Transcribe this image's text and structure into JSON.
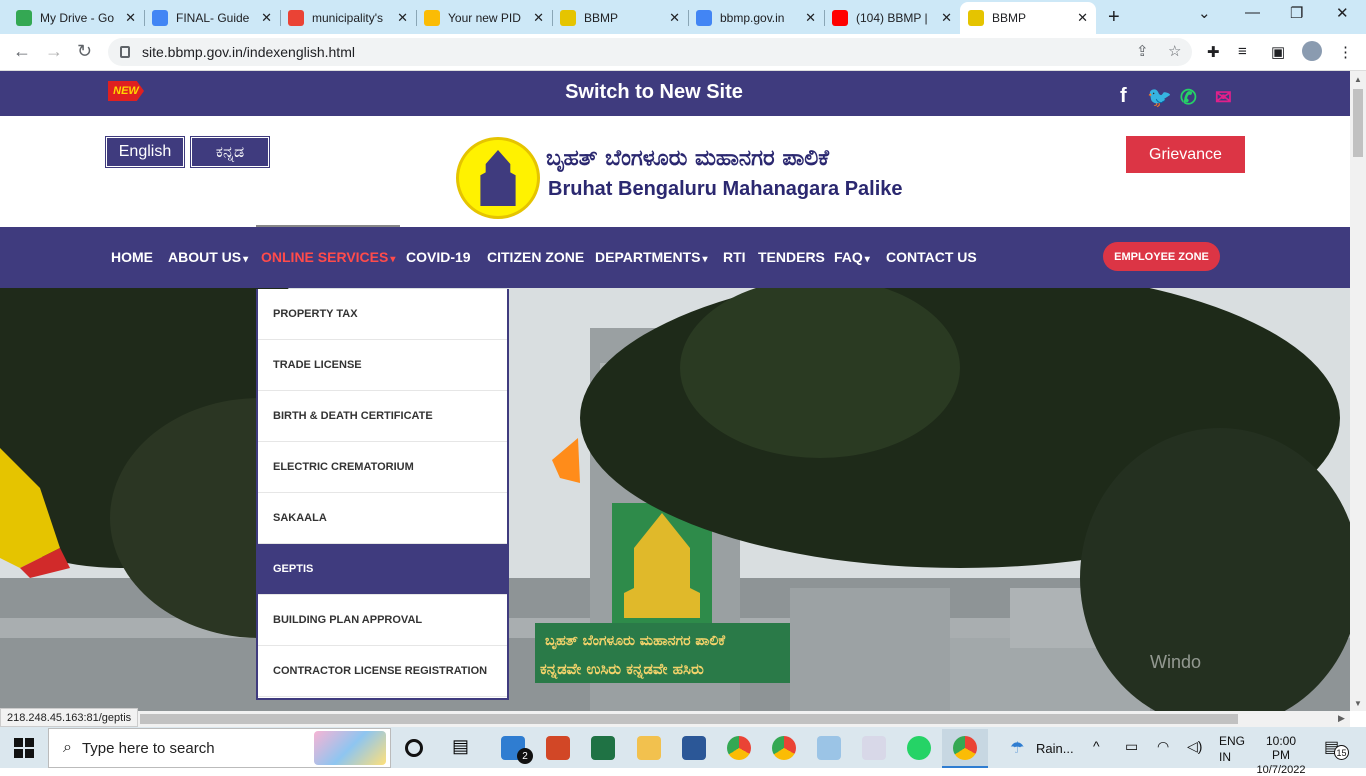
{
  "browser": {
    "tabs": [
      {
        "title": "My Drive - Go",
        "color": "#34a853"
      },
      {
        "title": "FINAL- Guide",
        "color": "#4285f4"
      },
      {
        "title": "municipality's",
        "color": "#ea4335"
      },
      {
        "title": "Your new PID",
        "color": "#fbbc05"
      },
      {
        "title": "BBMP",
        "color": "#e5c400"
      },
      {
        "title": "bbmp.gov.in",
        "color": "#4285f4"
      },
      {
        "title": "(104) BBMP |",
        "color": "#ff0000"
      },
      {
        "title": "BBMP",
        "color": "#e5c400"
      }
    ],
    "url": "site.bbmp.gov.in/indexenglish.html",
    "status_url": "218.248.45.163:81/geptis"
  },
  "banner": {
    "new_badge": "NEW",
    "switch_text": "Switch to New Site",
    "social": [
      {
        "icon": "facebook-icon",
        "glyph": "f",
        "color": "#ffffff"
      },
      {
        "icon": "twitter-icon",
        "glyph": "🐦",
        "color": "#1da1f2"
      },
      {
        "icon": "whatsapp-icon",
        "glyph": "✆",
        "color": "#25d366"
      },
      {
        "icon": "sahaaya-icon",
        "glyph": "✉",
        "color": "#e0208a"
      }
    ]
  },
  "header": {
    "lang_english": "English",
    "lang_kannada": "ಕನ್ನಡ",
    "title_kannada": "ಬೃಹತ್ ಬೆಂಗಳೂರು ಮಹಾನಗರ ಪಾಲಿಕೆ",
    "title_english": "Bruhat Bengaluru Mahanagara Palike",
    "grievance": "Grievance"
  },
  "nav": {
    "items": [
      {
        "label": "HOME",
        "caret": ""
      },
      {
        "label": "ABOUT US",
        "caret": "▾"
      },
      {
        "label": "ONLINE SERVICES",
        "caret": "▾"
      },
      {
        "label": "COVID-19",
        "caret": ""
      },
      {
        "label": "CITIZEN ZONE",
        "caret": ""
      },
      {
        "label": "DEPARTMENTS",
        "caret": "▾"
      },
      {
        "label": "RTI",
        "caret": ""
      },
      {
        "label": "TENDERS",
        "caret": ""
      },
      {
        "label": "FAQ",
        "caret": "▾"
      },
      {
        "label": "CONTACT US",
        "caret": ""
      }
    ],
    "employee_zone": "EMPLOYEE ZONE"
  },
  "online_services_menu": [
    "PROPERTY TAX",
    "TRADE LICENSE",
    "BIRTH & DEATH CERTIFICATE",
    "ELECTRIC CREMATORIUM",
    "SAKAALA",
    "GEPTIS",
    "BUILDING PLAN APPROVAL",
    "CONTRACTOR LICENSE REGISTRATION"
  ],
  "hero": {
    "sign_line1": "ಬೃಹತ್ ಬೆಂಗಳೂರು ಮಹಾನಗರ ಪಾಲಿಕೆ",
    "sign_line2": "ಕನ್ನಡವೇ ಉಸಿರು ಕನ್ನಡವೇ ಹಸಿರು",
    "watermark": "Windo"
  },
  "taskbar": {
    "search_placeholder": "Type here to search",
    "mail_badge": "2",
    "weather": "Rain...",
    "lang1": "ENG",
    "lang2": "IN",
    "time": "10:00 PM",
    "date": "10/7/2022",
    "notifications": "15"
  }
}
